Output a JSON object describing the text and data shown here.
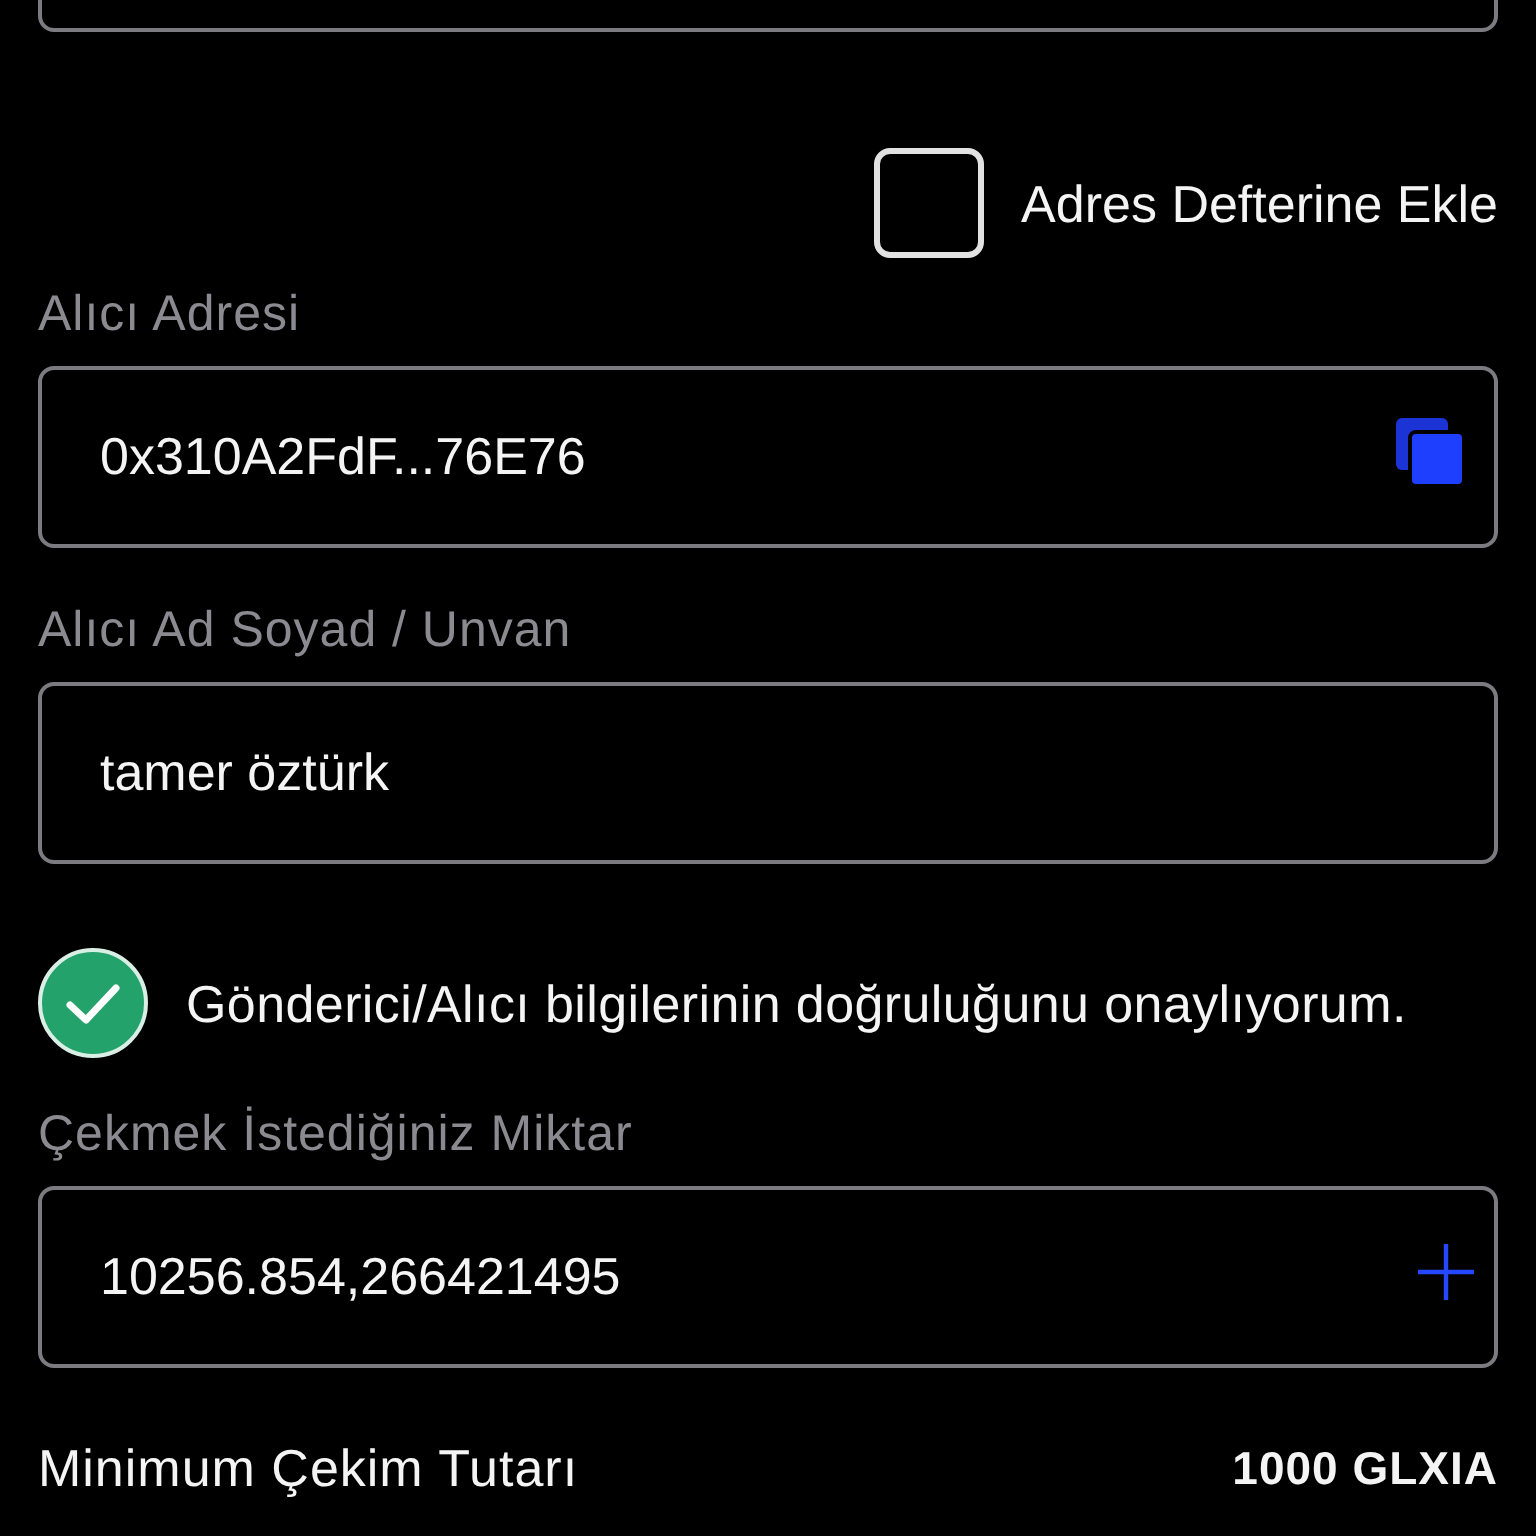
{
  "address_book": {
    "label": "Adres Defterine Ekle",
    "checked": false
  },
  "recipient_fields": [
    {
      "kind": "copy",
      "label": "Alıcı Adresi",
      "value": "0x310A2FdF...76E76"
    },
    {
      "kind": "text",
      "label": "Alıcı Ad Soyad / Unvan",
      "value": "tamer öztürk"
    }
  ],
  "confirmation": {
    "label": "Gönderici/Alıcı bilgilerinin doğruluğunu onaylıyorum.",
    "checked": true
  },
  "amount_field": {
    "kind": "plus",
    "label": "Çekmek İstediğiniz Miktar",
    "value": "10256.854,266421495"
  },
  "summary_rows": [
    {
      "label": "Minimum Çekim Tutarı",
      "value": "1000 GLXIA"
    }
  ]
}
